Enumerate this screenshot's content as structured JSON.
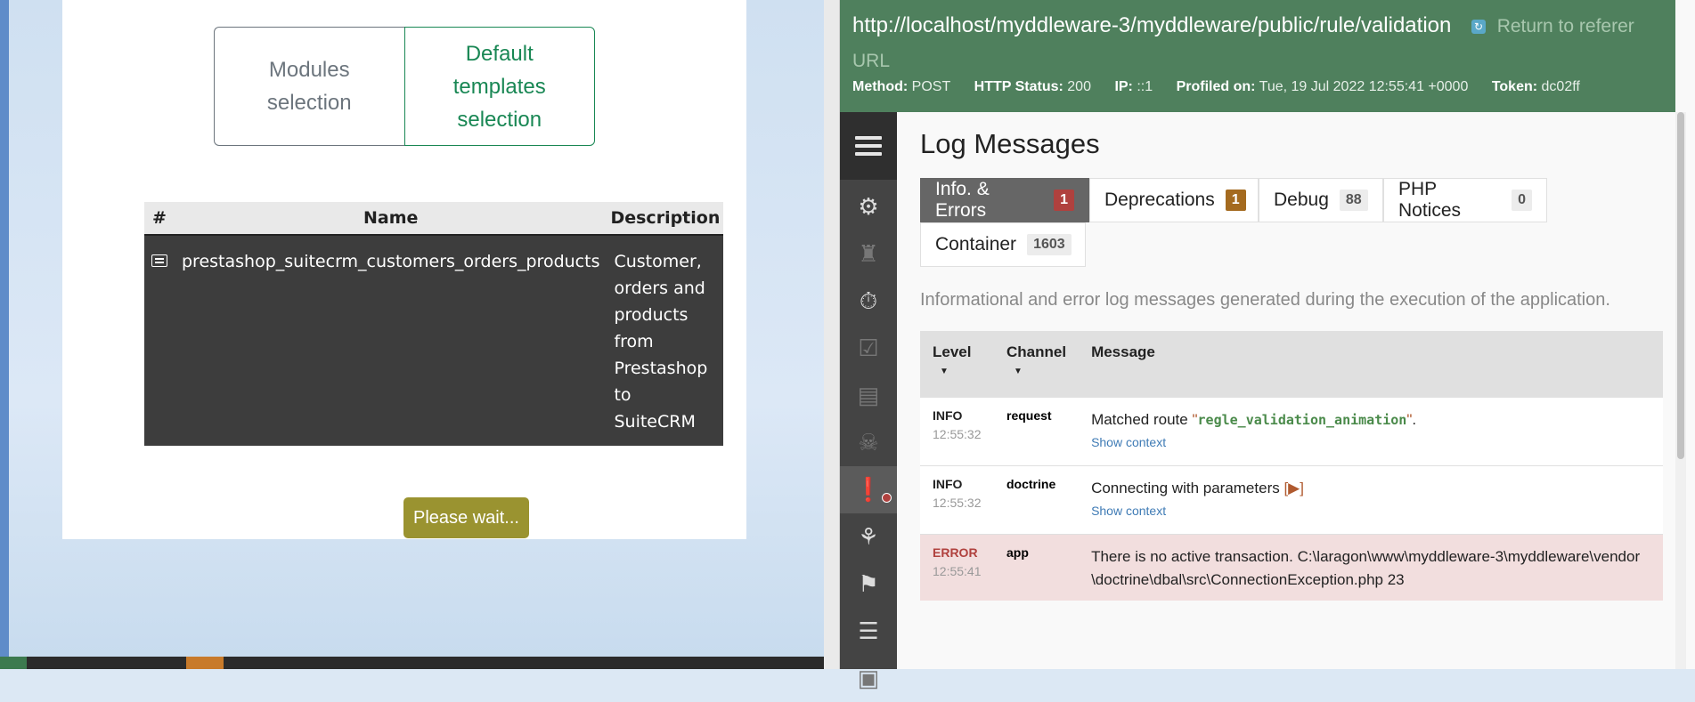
{
  "wizard": {
    "tabs": [
      {
        "label": "Modules selection"
      },
      {
        "label": "Default templates selection"
      }
    ],
    "table": {
      "headers": [
        "#",
        "Name",
        "Description"
      ],
      "rows": [
        {
          "name": "prestashop_suitecrm_customers_orders_products",
          "description": "Customer, orders and products from Prestashop to SuiteCRM"
        }
      ]
    },
    "wait_button": "Please wait..."
  },
  "profiler": {
    "url": "http://localhost/myddleware-3/myddleware/public/rule/validation",
    "return_link": "Return to referer URL",
    "meta": {
      "method_label": "Method:",
      "method": "POST",
      "status_label": "HTTP Status:",
      "status": "200",
      "ip_label": "IP:",
      "ip": "::1",
      "profiled_label": "Profiled on:",
      "profiled": "Tue, 19 Jul 2022 12:55:41 +0000",
      "token_label": "Token:",
      "token": "dc02ff"
    },
    "title": "Log Messages",
    "tabs": [
      {
        "label": "Info. & Errors",
        "count": "1"
      },
      {
        "label": "Deprecations",
        "count": "1"
      },
      {
        "label": "Debug",
        "count": "88"
      },
      {
        "label": "PHP Notices",
        "count": "0"
      },
      {
        "label": "Container",
        "count": "1603"
      }
    ],
    "description": "Informational and error log messages generated during the execution of the application.",
    "log_headers": {
      "level": "Level",
      "channel": "Channel",
      "message": "Message"
    },
    "logs": [
      {
        "level": "INFO",
        "time": "12:55:32",
        "channel": "request",
        "message_prefix": "Matched route ",
        "route": "regle_validation_animation",
        "message_suffix": ".",
        "context": "Show context"
      },
      {
        "level": "INFO",
        "time": "12:55:32",
        "channel": "doctrine",
        "message_prefix": "Connecting with parameters ",
        "expander": "[▶]",
        "context": "Show context"
      },
      {
        "level": "ERROR",
        "time": "12:55:41",
        "channel": "app",
        "message": "There is no active transaction. C:\\laragon\\www\\myddleware-3\\myddleware\\vendor\\doctrine\\dbal\\src\\ConnectionException.php 23"
      }
    ],
    "sidebar_icons": [
      "menu-icon",
      "config-icon",
      "rocket-icon",
      "timer-icon",
      "validator-icon",
      "forms-icon",
      "ghost-icon",
      "logs-icon",
      "events-icon",
      "router-icon",
      "layers-icon",
      "cache-icon"
    ]
  }
}
